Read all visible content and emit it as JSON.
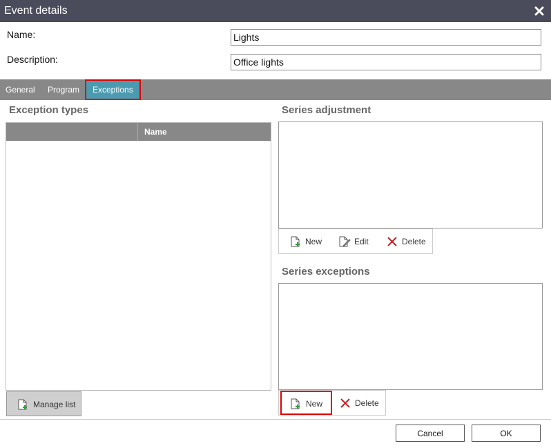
{
  "dialog": {
    "title": "Event details",
    "close_icon": "close-icon"
  },
  "form": {
    "name_label": "Name:",
    "name_value": "Lights",
    "description_label": "Description:",
    "description_value": "Office lights"
  },
  "tabs": [
    {
      "label": "General",
      "active": false
    },
    {
      "label": "Program",
      "active": false
    },
    {
      "label": "Exceptions",
      "active": true
    }
  ],
  "exception_types": {
    "heading": "Exception types",
    "columns": [
      "",
      "Name"
    ],
    "rows": [],
    "manage_button": {
      "label": "Manage list",
      "icon": "add-document-icon"
    }
  },
  "series_adjustment": {
    "heading": "Series adjustment",
    "items": [],
    "toolbar": {
      "new_label": "New",
      "edit_label": "Edit",
      "delete_label": "Delete"
    }
  },
  "series_exceptions": {
    "heading": "Series exceptions",
    "items": [],
    "toolbar": {
      "new_label": "New",
      "delete_label": "Delete"
    }
  },
  "footer": {
    "cancel_label": "Cancel",
    "ok_label": "OK"
  },
  "colors": {
    "titlebar": "#4a4c5c",
    "tabbar": "#888888",
    "active_tab": "#4a9bb0",
    "highlight_border": "#e00000",
    "add_icon_green": "#2e9e3a",
    "delete_icon_red": "#c81e1e",
    "heading_gray": "#666666"
  }
}
